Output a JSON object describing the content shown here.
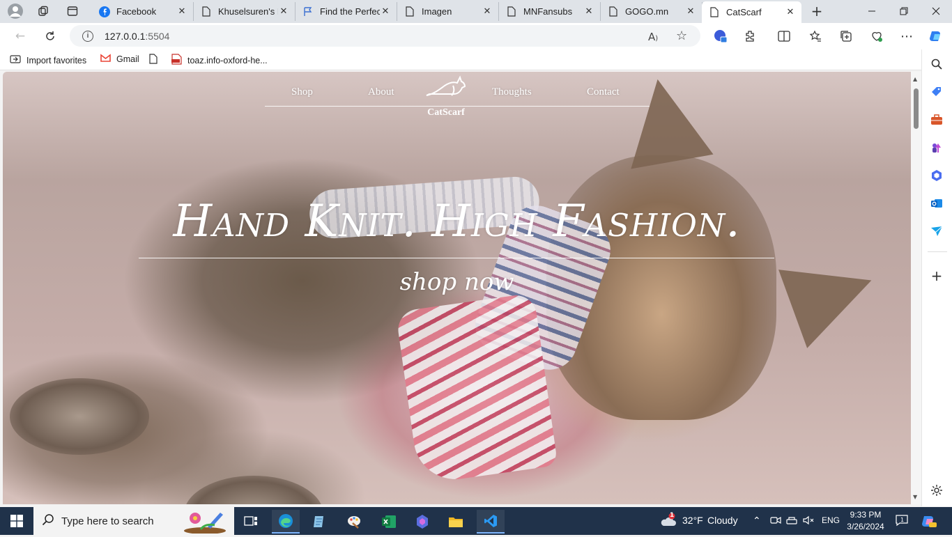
{
  "browser": {
    "tabs": [
      {
        "label": "Facebook",
        "icon": "facebook-icon",
        "active": false
      },
      {
        "label": "Khuselsuren's P",
        "icon": "page-icon",
        "active": false
      },
      {
        "label": "Find the Perfect",
        "icon": "flag-icon",
        "active": false
      },
      {
        "label": "Imagen",
        "icon": "page-icon",
        "active": false
      },
      {
        "label": "MNFansubs",
        "icon": "page-icon",
        "active": false
      },
      {
        "label": "GOGO.mn",
        "icon": "page-icon",
        "active": false
      },
      {
        "label": "CatScarf",
        "icon": "page-icon",
        "active": true
      }
    ],
    "close_glyph": "✕",
    "new_tab_glyph": "+",
    "url_host": "127.0.0.1",
    "url_port": ":5504",
    "favorites": [
      {
        "label": "Import favorites",
        "icon": "import-icon"
      },
      {
        "label": "Gmail",
        "icon": "gmail-icon"
      },
      {
        "label": "",
        "icon": "page-icon"
      },
      {
        "label": "toaz.info-oxford-he...",
        "icon": "pdf-icon"
      }
    ]
  },
  "site": {
    "nav": {
      "shop": "Shop",
      "about": "About",
      "thoughts": "Thoughts",
      "contact": "Contact",
      "logo_name": "CatScarf"
    },
    "headline": "Hand Knit. High Fashion.",
    "cta": "shop now"
  },
  "taskbar": {
    "search_placeholder": "Type here to search",
    "weather_temp": "32°F",
    "weather_text": "Cloudy",
    "weather_badge": "1",
    "language": "ENG",
    "time": "9:33 PM",
    "date": "3/26/2024"
  },
  "colors": {
    "taskbar": "#20324a",
    "accent": "#0078d4"
  }
}
